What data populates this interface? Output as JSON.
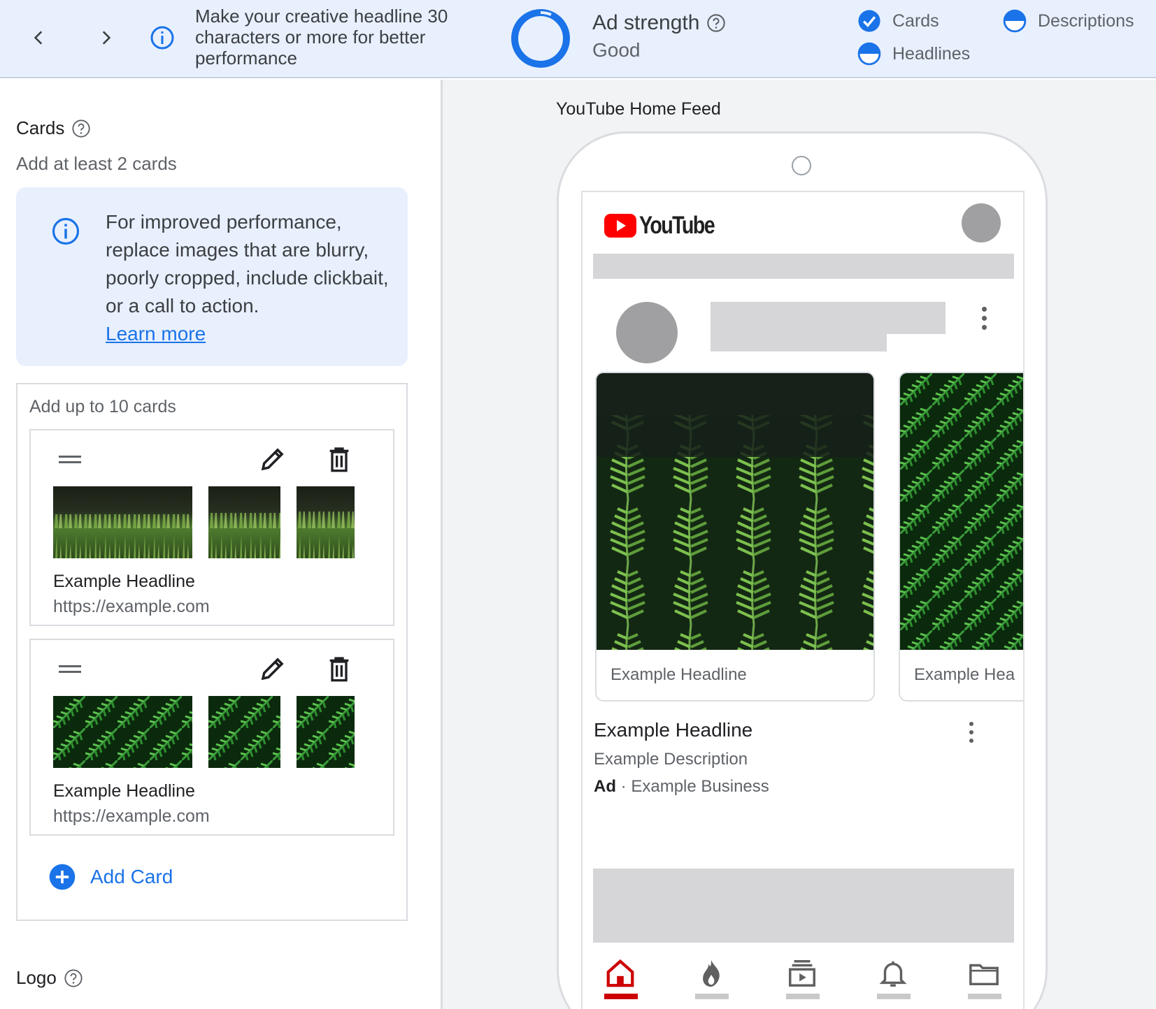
{
  "topbar": {
    "tip_text": "Make your creative headline 30 characters or more for better performance",
    "ad_strength_title": "Ad strength",
    "ad_strength_value": "Good",
    "status": {
      "cards": "Cards",
      "headlines": "Headlines",
      "descriptions": "Descriptions"
    },
    "accent_color": "#1a73e8"
  },
  "cards_section": {
    "title": "Cards",
    "subtitle": "Add at least 2 cards",
    "info_message": "For improved performance, replace images that are blurry, poorly cropped, include clickbait, or a call to action.",
    "learn_more": "Learn more",
    "list_hint": "Add up to 10 cards",
    "cards": [
      {
        "headline": "Example Headline",
        "url": "https://example.com",
        "image": "grass-field-photo"
      },
      {
        "headline": "Example Headline",
        "url": "https://example.com",
        "image": "fern-leaves-photo"
      }
    ],
    "add_card_label": "Add Card"
  },
  "logo_section": {
    "title": "Logo"
  },
  "preview": {
    "label": "YouTube Home Feed",
    "app_name": "YouTube",
    "carousel": [
      {
        "label": "Example Headline"
      },
      {
        "label": "Example Hea"
      }
    ],
    "ad_headline": "Example Headline",
    "ad_description": "Example Description",
    "ad_badge": "Ad",
    "ad_separator": "·",
    "ad_business": "Example Business",
    "nav_icons": [
      "home-icon",
      "explore-flame-icon",
      "subscriptions-icon",
      "notifications-bell-icon",
      "library-folder-icon"
    ],
    "active_nav": "home-icon",
    "brand_red": "#ff0000"
  }
}
